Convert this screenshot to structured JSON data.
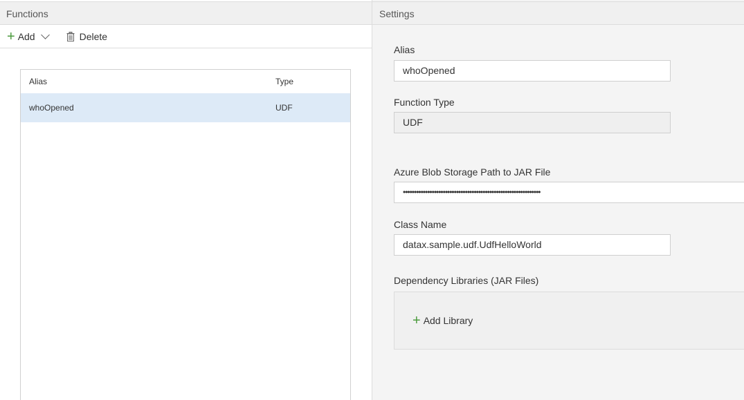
{
  "functions_panel": {
    "title": "Functions",
    "toolbar": {
      "add_label": "Add",
      "delete_label": "Delete"
    },
    "table": {
      "columns": [
        "Alias",
        "Type"
      ],
      "rows": [
        {
          "alias": "whoOpened",
          "type": "UDF",
          "selected": true
        }
      ]
    }
  },
  "settings_panel": {
    "title": "Settings",
    "alias": {
      "label": "Alias",
      "value": "whoOpened"
    },
    "function_type": {
      "label": "Function Type",
      "value": "UDF"
    },
    "jar_path": {
      "label": "Azure Blob Storage Path to JAR File",
      "value": "••••••••••••••••••••••••••••••••••••••••••••••••••••••••••••••"
    },
    "class_name": {
      "label": "Class Name",
      "value": "datax.sample.udf.UdfHelloWorld"
    },
    "dependency_libraries": {
      "label": "Dependency Libraries (JAR Files)",
      "add_label": "Add Library"
    }
  },
  "colors": {
    "accent_green": "#4a9a3c",
    "selected_row": "#ddeaf7",
    "header_bg": "#f0f0f0"
  },
  "icons": [
    "plus-icon",
    "chevron-down-icon",
    "trash-icon"
  ]
}
